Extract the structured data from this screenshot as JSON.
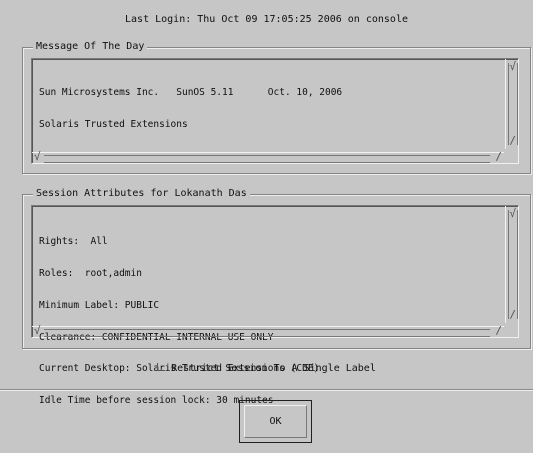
{
  "header": {
    "last_login": "Last Login: Thu Oct 09 17:05:25 2006 on console"
  },
  "motd": {
    "title": "Message Of The Day",
    "lines": [
      "Sun Microsystems Inc.   SunOS 5.11      Oct. 10, 2006",
      "Solaris Trusted Extensions"
    ]
  },
  "session": {
    "title": "Session Attributes for Lokanath Das",
    "lines": [
      "Rights:  All",
      "Roles:  root,admin",
      "Minimum Label: PUBLIC",
      "Clearance: CONFIDENTIAL INTERNAL USE ONLY",
      "Current Desktop: Solaris Trusted Extensions (CDE)",
      "Idle Time before session lock: 30 minutes"
    ]
  },
  "restrict": {
    "label": "Restrict Session To A Single Label",
    "checked": false
  },
  "buttons": {
    "ok": "OK"
  }
}
